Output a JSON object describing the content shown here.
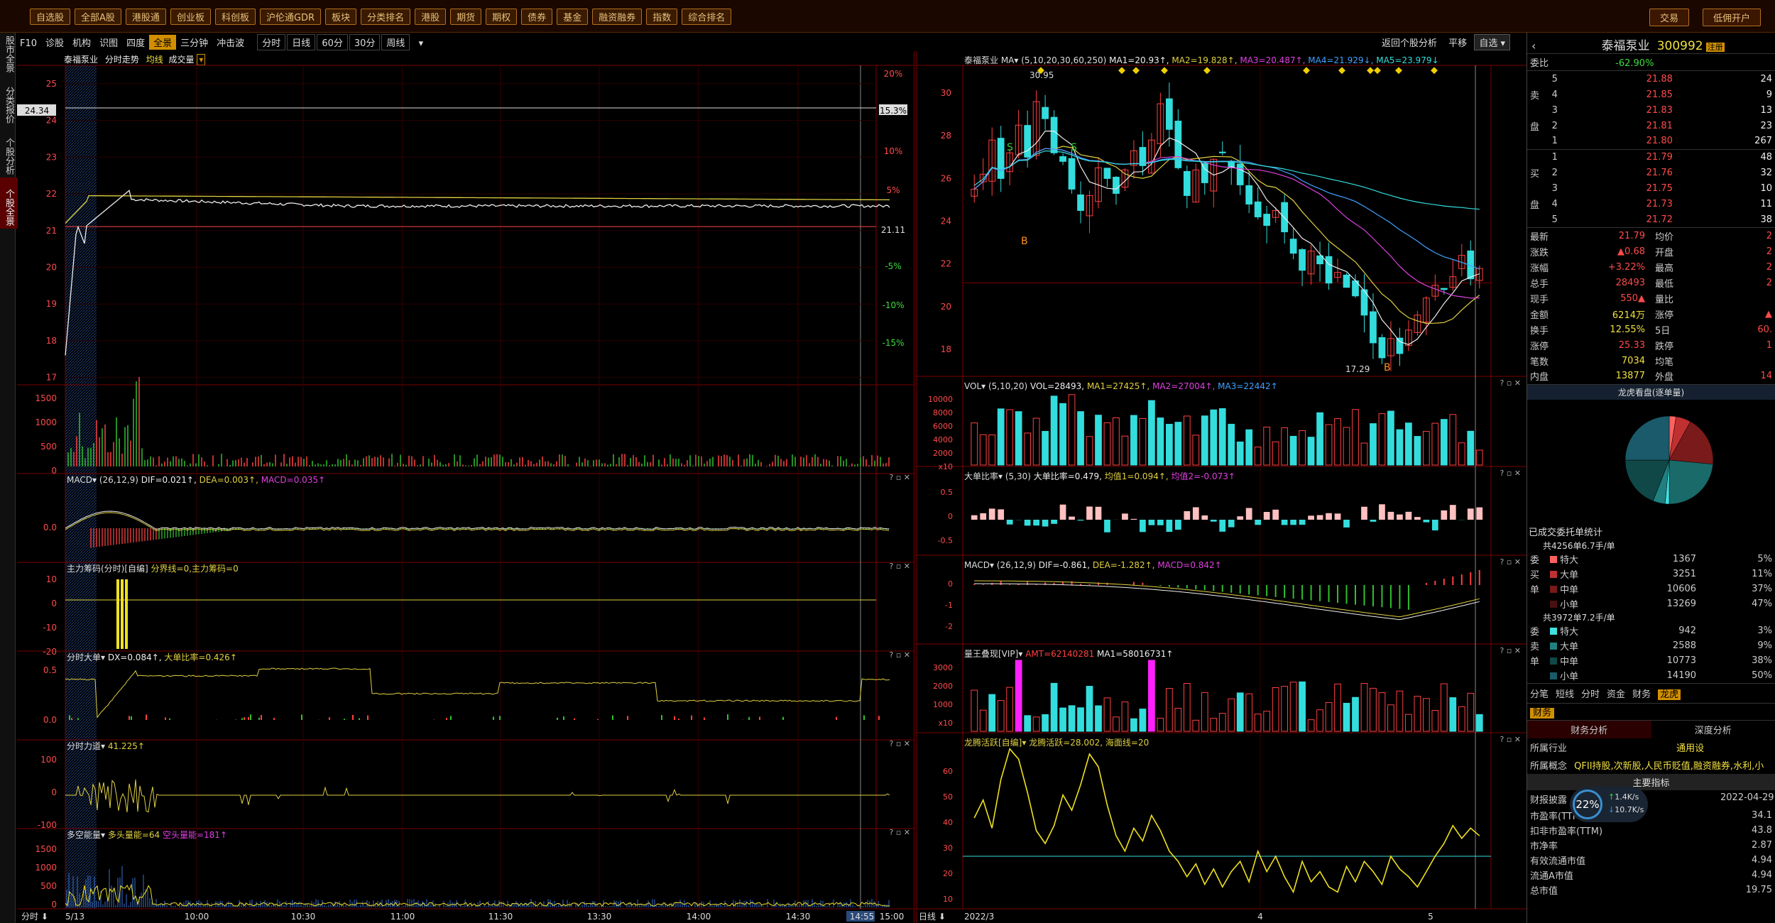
{
  "menu": {
    "items": [
      "自选股",
      "全部A股",
      "港股通",
      "创业板",
      "科创板",
      "沪伦通GDR",
      "板块",
      "分类排名",
      "港股",
      "期货",
      "期权",
      "债券",
      "基金",
      "融资融券",
      "指数",
      "综合排名"
    ]
  },
  "top_buttons": {
    "trade": "交易",
    "open_account": "低佣开户"
  },
  "left_rail": {
    "items": [
      "股市全景",
      "分类报价",
      "个股分析",
      "个股全景"
    ]
  },
  "toolbar": {
    "left": [
      "F10",
      "诊股",
      "机构",
      "识图",
      "四度",
      "全景",
      "三分钟",
      "冲击波"
    ],
    "active": "全景",
    "periods": [
      "分时",
      "日线",
      "60分",
      "30分",
      "周线"
    ],
    "right": {
      "back": "返回个股分析",
      "flat": "平移",
      "watchlist": "自选"
    }
  },
  "intraday": {
    "header": {
      "name": "泰福泵业",
      "trend": "分时走势",
      "avg": "均线",
      "vol": "成交量"
    },
    "price_labels": [
      "25",
      "24",
      "23",
      "22",
      "21",
      "20",
      "19",
      "18",
      "17"
    ],
    "pct_labels": [
      "20%",
      "15.3%",
      "10%",
      "5%",
      "21.11",
      "-5%",
      "-10%",
      "-15%"
    ],
    "left_marker": "24.34",
    "vol_labels": [
      "1500",
      "1000",
      "500",
      "0"
    ],
    "macd": {
      "title": "MACD",
      "params": "(26,12,9)",
      "dif": "DIF=0.021",
      "dea": "DEA=0.003",
      "macd": "MACD=0.035",
      "scale": "0.0"
    },
    "chip": {
      "title": "主力筹码(分时)[自编]",
      "line": "分界线=0,主力筹码=0",
      "labels": [
        "10",
        "0",
        "-10",
        "-20"
      ]
    },
    "big": {
      "title": "分时大单",
      "dx": "DX=0.084",
      "ratio": "大单比率=0.426",
      "labels": [
        "0.5",
        "0.0"
      ]
    },
    "force": {
      "title": "分时力道",
      "val": "41.225",
      "labels": [
        "100",
        "0",
        "-100"
      ]
    },
    "energy": {
      "title": "多空能量",
      "long": "多头量能=64",
      "short": "空头量能=181",
      "labels": [
        "1500",
        "1000",
        "500",
        "0"
      ]
    },
    "time_axis": [
      "5/13",
      "10:00",
      "10:30",
      "11:00",
      "11:30",
      "13:30",
      "14:00",
      "14:30",
      "14:55",
      "15:00"
    ],
    "axis_btn": "分时"
  },
  "daily": {
    "header": {
      "name": "泰福泵业",
      "ma": "MA",
      "params": "(5,10,20,30,60,250)",
      "ma1": "MA1=20.93",
      "ma2": "MA2=19.828",
      "ma3": "MA3=20.487",
      "ma4": "MA4=21.929",
      "ma5": "MA5=23.979"
    },
    "high_mark": "30.95",
    "low_mark": "17.29",
    "price_labels": [
      "30",
      "28",
      "26",
      "24",
      "22",
      "20",
      "18"
    ],
    "vol": {
      "title": "VOL",
      "params": "(5,10,20)",
      "v": "VOL=28493",
      "ma1": "MA1=27425",
      "ma2": "MA2=27004",
      "ma3": "MA3=22442",
      "labels": [
        "10000",
        "8000",
        "6000",
        "4000",
        "2000",
        "x10"
      ]
    },
    "bigratio": {
      "title": "大单比率",
      "params": "(5,30)",
      "v": "大单比率=0.479",
      "m1": "均值1=0.094",
      "m2": "均值2=-0.073",
      "labels": [
        "0.5",
        "0",
        "-0.5"
      ]
    },
    "macd": {
      "title": "MACD",
      "params": "(26,12,9)",
      "dif": "DIF=-0.861",
      "dea": "DEA=-1.282",
      "macd": "MACD=0.842",
      "labels": [
        "0",
        "-1",
        "-2"
      ]
    },
    "qty": {
      "title": "量王叠现[VIP]",
      "amt": "AMT=62140281",
      "ma1": "MA1=58016731",
      "labels": [
        "3000",
        "2000",
        "1000",
        "x10"
      ]
    },
    "dragon": {
      "title": "龙腾活跃[自编]",
      "v": "龙腾活跃=28.002",
      "sea": "海面线=20",
      "labels": [
        "60",
        "50",
        "40",
        "30",
        "20",
        "10"
      ]
    },
    "time_axis": [
      "2022/3",
      "4",
      "5"
    ],
    "axis_btn": "日线"
  },
  "quote": {
    "name": "泰福泵业",
    "code": "300992",
    "badge": "注册",
    "weibi_label": "委比",
    "weibi": "-62.90%",
    "sell": [
      {
        "lvl": "5",
        "price": "21.88",
        "vol": "24"
      },
      {
        "lvl": "4",
        "price": "21.85",
        "vol": "9"
      },
      {
        "lvl": "3",
        "price": "21.83",
        "vol": "13"
      },
      {
        "lvl": "2",
        "price": "21.81",
        "vol": "23"
      },
      {
        "lvl": "1",
        "price": "21.80",
        "vol": "267"
      }
    ],
    "buy": [
      {
        "lvl": "1",
        "price": "21.79",
        "vol": "48"
      },
      {
        "lvl": "2",
        "price": "21.76",
        "vol": "32"
      },
      {
        "lvl": "3",
        "price": "21.75",
        "vol": "10"
      },
      {
        "lvl": "4",
        "price": "21.73",
        "vol": "11"
      },
      {
        "lvl": "5",
        "price": "21.72",
        "vol": "38"
      }
    ],
    "sell_side": "卖",
    "buy_side": "买",
    "pan": "盘",
    "stats": [
      [
        "最新",
        "21.79",
        "均价",
        "2"
      ],
      [
        "涨跌",
        "▲0.68",
        "开盘",
        "2"
      ],
      [
        "涨幅",
        "+3.22%",
        "最高",
        "2"
      ],
      [
        "总手",
        "28493",
        "最低",
        "2"
      ],
      [
        "现手",
        "550▲",
        "量比",
        ""
      ],
      [
        "金额",
        "6214万",
        "涨停",
        "▲"
      ],
      [
        "换手",
        "12.55%",
        "5日",
        "60."
      ],
      [
        "涨停",
        "25.33",
        "跌停",
        "1"
      ],
      [
        "笔数",
        "7034",
        "均笔",
        ""
      ],
      [
        "内盘",
        "13877",
        "外盘",
        "14"
      ]
    ],
    "pie_title": "龙虎看盘(逐单量)",
    "done_title": "已成交委托单统计",
    "sum1": "共4256单6.7手/单",
    "sum2": "共3972单7.2手/单",
    "buy_rows": [
      [
        "特大",
        "1367",
        "5%"
      ],
      [
        "大单",
        "3251",
        "11%"
      ],
      [
        "中单",
        "10606",
        "37%"
      ],
      [
        "小单",
        "13269",
        "47%"
      ]
    ],
    "sell_rows": [
      [
        "特大",
        "942",
        "3%"
      ],
      [
        "大单",
        "2588",
        "9%"
      ],
      [
        "中单",
        "10773",
        "38%"
      ],
      [
        "小单",
        "14190",
        "50%"
      ]
    ],
    "side_b": [
      "委",
      "买",
      "单"
    ],
    "side_s": [
      "委",
      "卖",
      "单"
    ],
    "tabs": [
      "分笔",
      "短线",
      "分时",
      "资金",
      "财务",
      "龙虎"
    ],
    "tab_active": "龙虎",
    "fin_tab": "财务",
    "fin_sub": [
      "财务分析",
      "深度分析"
    ],
    "industry_label": "所属行业",
    "industry": "通用设",
    "concept_label": "所属概念",
    "concept": "QFII持股,次新股,人民币贬值,融资融券,水利,小",
    "key_title": "主要指标",
    "report_label": "财报披露",
    "report_date": "2022-04-29",
    "rows": [
      [
        "市盈率(TTM)",
        "34.1"
      ],
      [
        "扣非市盈率(TTM)",
        "43.8"
      ],
      [
        "市净率",
        "2.87"
      ],
      [
        "有效流通市值",
        "4.94"
      ],
      [
        "流通A市值",
        "4.94"
      ],
      [
        "总市值",
        "19.75"
      ]
    ],
    "net": {
      "pct": "22",
      "up": "1.4",
      "down": "10.7",
      "unit": "K/s"
    }
  }
}
